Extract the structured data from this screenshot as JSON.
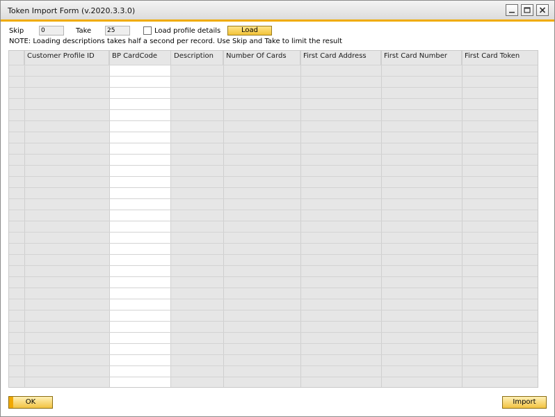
{
  "window": {
    "title": "Token Import Form (v.2020.3.3.0)",
    "controls": [
      "minimize-icon",
      "maximize-icon",
      "close-icon"
    ],
    "accent": "#f0ab00"
  },
  "form": {
    "skip_label": "Skip",
    "skip_value": "0",
    "take_label": "Take",
    "take_value": "25",
    "load_profile_label": "Load profile details",
    "load_profile_checked": false,
    "load_button": "Load",
    "note": "NOTE: Loading descriptions takes half a second per record. Use Skip and Take to limit the result"
  },
  "table": {
    "columns": [
      "Customer Profile ID",
      "BP CardCode",
      "Description",
      "Number Of Cards",
      "First Card Address",
      "First Card Number",
      "First Card Token"
    ],
    "rows": []
  },
  "footer": {
    "ok_button": "OK",
    "import_button": "Import"
  }
}
